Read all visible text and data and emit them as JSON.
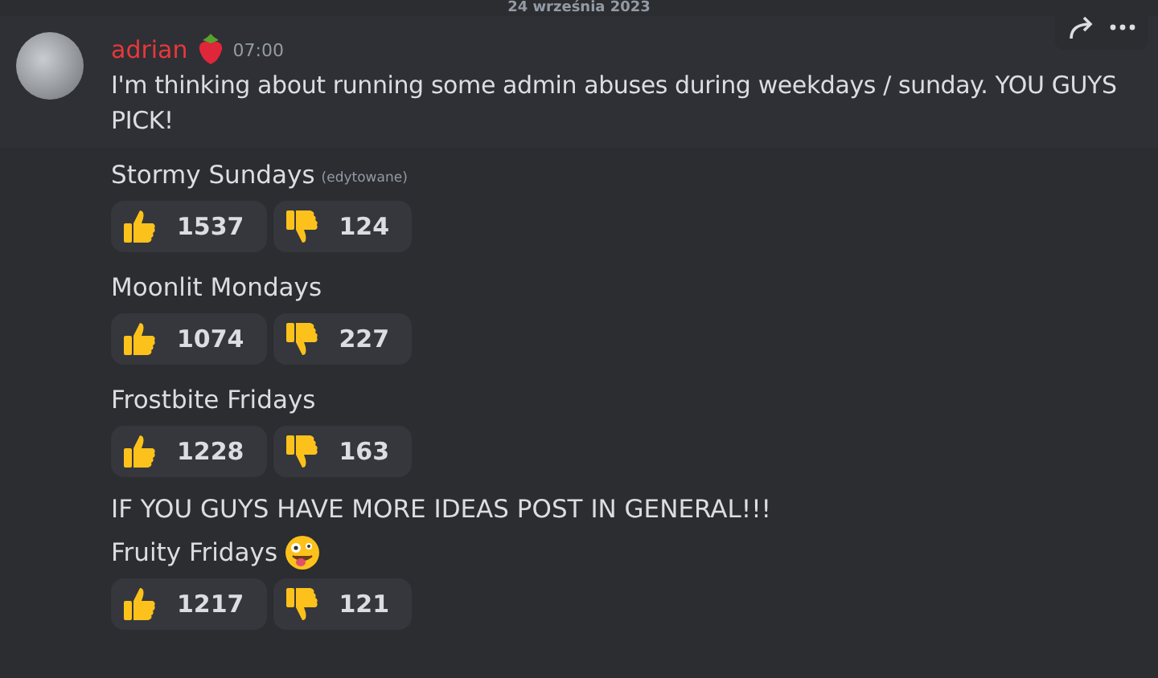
{
  "date_divider": "24 września 2023",
  "message": {
    "author": "adrian",
    "time": "07:00",
    "text": "I'm thinking about running some admin abuses during weekdays / sunday. YOU GUYS PICK!"
  },
  "blocks": [
    {
      "kind": "poll",
      "title": "Stormy Sundays",
      "edited": "(edytowane)",
      "has_emoji": false,
      "reactions": [
        {
          "kind": "up",
          "count": "1537"
        },
        {
          "kind": "down",
          "count": "124"
        }
      ]
    },
    {
      "kind": "poll",
      "title": "Moonlit Mondays",
      "has_emoji": false,
      "reactions": [
        {
          "kind": "up",
          "count": "1074"
        },
        {
          "kind": "down",
          "count": "227"
        }
      ]
    },
    {
      "kind": "poll",
      "title": "Frostbite Fridays",
      "has_emoji": false,
      "reactions": [
        {
          "kind": "up",
          "count": "1228"
        },
        {
          "kind": "down",
          "count": "163"
        }
      ]
    },
    {
      "kind": "note",
      "text": "IF YOU GUYS HAVE MORE IDEAS POST IN GENERAL!!!"
    },
    {
      "kind": "poll",
      "title": "Fruity Fridays",
      "has_emoji": true,
      "reactions": [
        {
          "kind": "up",
          "count": "1217"
        },
        {
          "kind": "down",
          "count": "121"
        }
      ]
    }
  ]
}
